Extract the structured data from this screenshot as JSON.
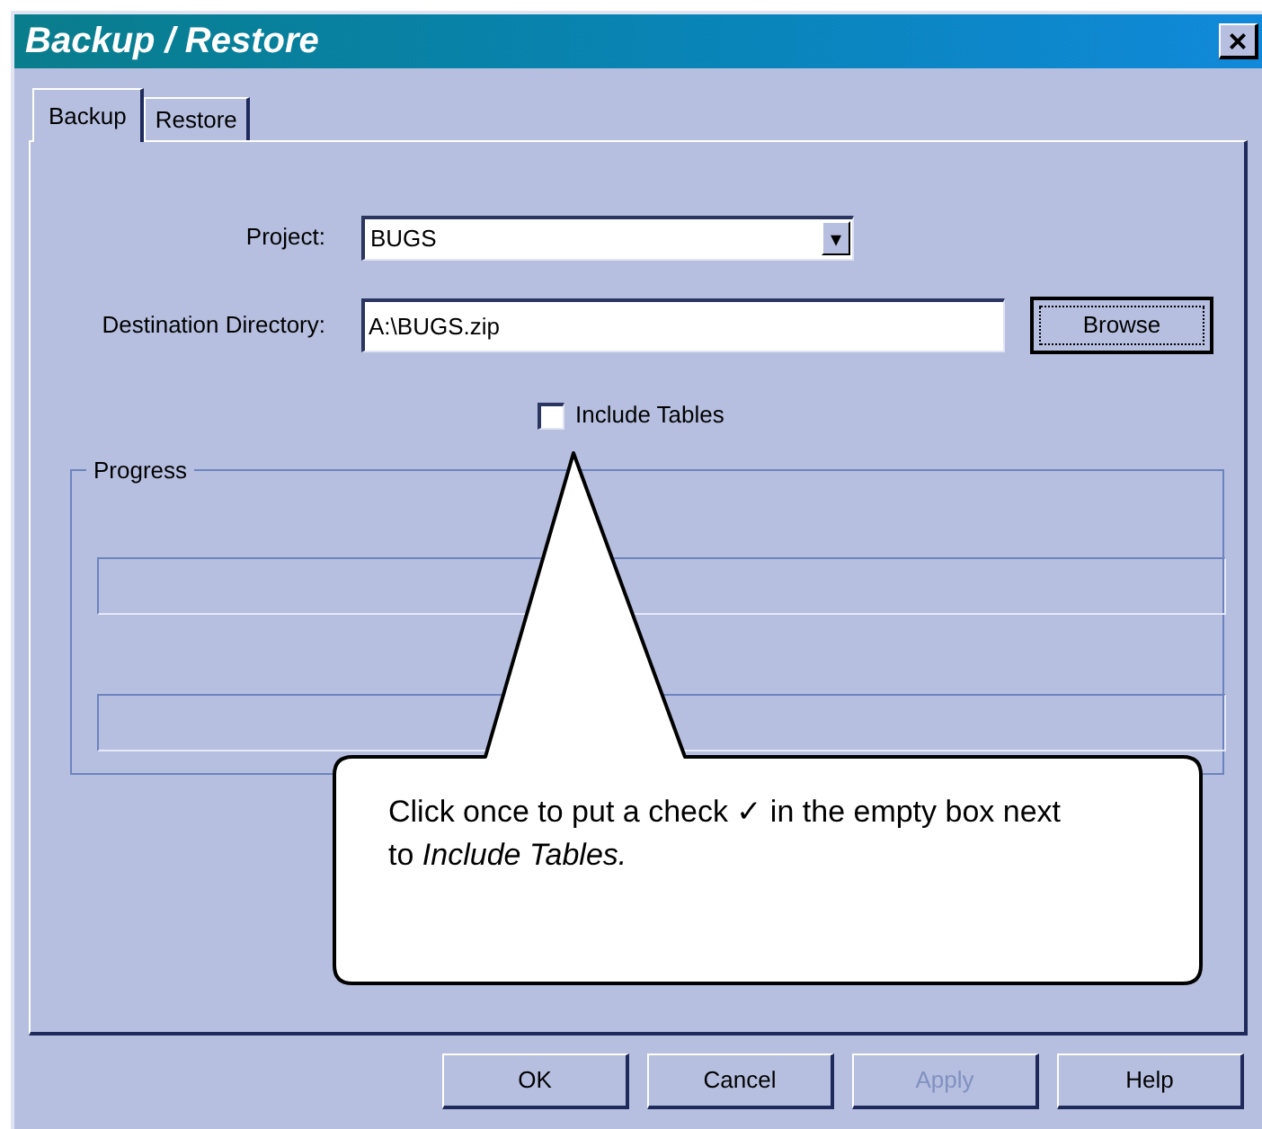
{
  "window": {
    "title": "Backup / Restore",
    "close": "×"
  },
  "tabs": [
    {
      "label": "Backup",
      "selected": true
    },
    {
      "label": "Restore",
      "selected": false
    }
  ],
  "project": {
    "label": "Project:",
    "value": "BUGS",
    "arrow": "▾"
  },
  "destination": {
    "label": "Destination Directory:",
    "value": "A:\\BUGS.zip",
    "button": "Browse"
  },
  "include_tables": {
    "label": "Include Tables",
    "checked": false
  },
  "progress": {
    "title": "Progress",
    "bars": [
      {
        "level": 0
      },
      {
        "level": 0
      }
    ]
  },
  "callout": {
    "text": "Click once to put a check ✓ in the empty box next to *Include Tables.*"
  },
  "buttons": [
    {
      "label": "OK",
      "disabled": false
    },
    {
      "label": "Cancel",
      "disabled": false
    },
    {
      "label": "Apply",
      "disabled": true
    },
    {
      "label": "Help",
      "disabled": false
    }
  ]
}
